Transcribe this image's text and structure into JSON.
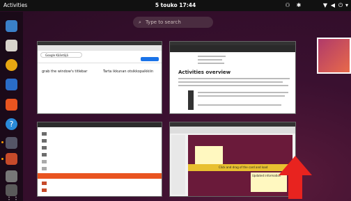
{
  "topbar": {
    "activities": "Activities",
    "clock": "5 touko  17:44",
    "tray_icons": [
      "network-icon",
      "audio-icon",
      "wifi-icon",
      "volume-icon",
      "battery-icon",
      "power-icon"
    ]
  },
  "search": {
    "placeholder": "Type to search"
  },
  "dock": {
    "apps": [
      "thunderbird-icon",
      "files-icon",
      "rhythmbox-icon",
      "writer-icon",
      "software-icon",
      "help-icon",
      "screenshot-icon",
      "text-editor-icon",
      "trash-icon",
      "file-manager-icon",
      "app-grid-icon"
    ]
  },
  "windows": {
    "translate": {
      "search_query": "Google Kääntäjä",
      "source_text": "grab the window's titlebar",
      "translated_text": "Tarta ikkunan otsikkopalkkiin"
    },
    "help": {
      "heading": "Activities overview"
    },
    "impress": {
      "labels": [
        "Click and drag of the card and load",
        "Updated information"
      ]
    }
  },
  "colors": {
    "accent": "#e95420",
    "arrow": "#e8231f"
  }
}
